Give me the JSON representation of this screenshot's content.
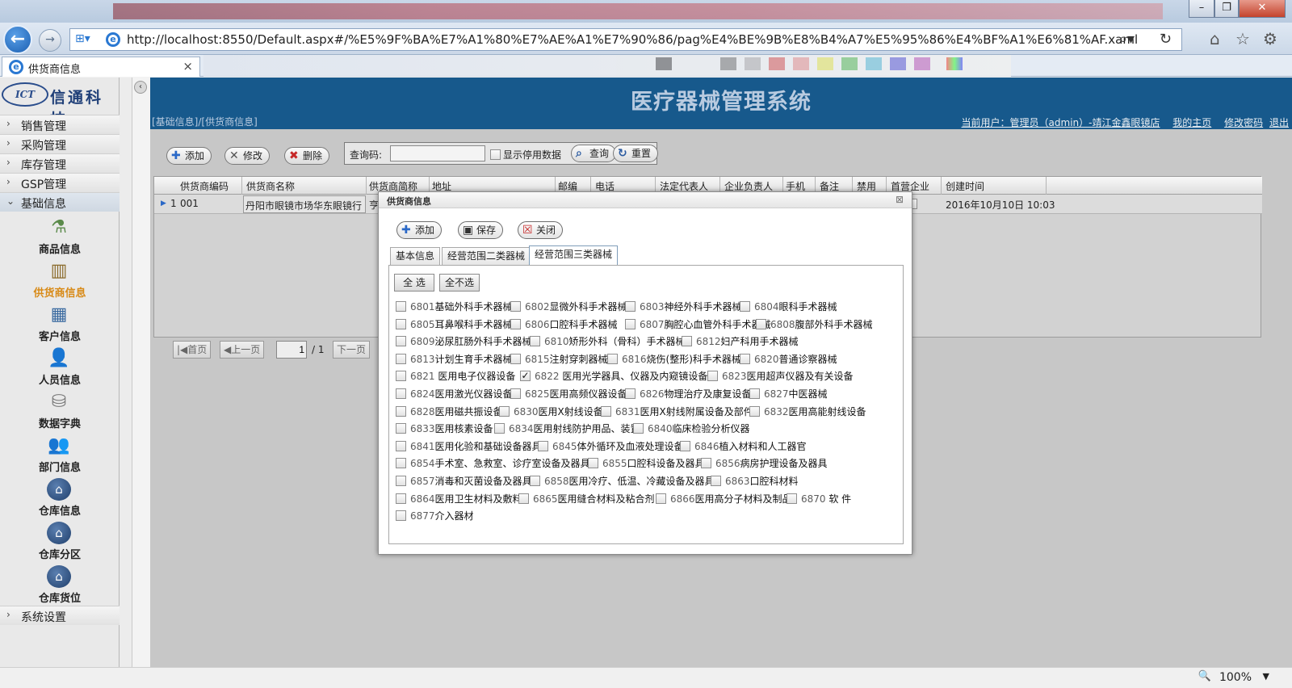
{
  "browser": {
    "url": "http://localhost:8550/Default.aspx#/%E5%9F%BA%E7%A1%80%E7%AE%A1%E7%90%86/pag%E4%BE%9B%E8%B4%A7%E5%95%86%E4%BF%A1%E6%81%AF.xaml",
    "tab_title": "供货商信息",
    "zoom": "100%"
  },
  "logo": {
    "mark": "ICT",
    "name": "信通科技"
  },
  "sidebar": {
    "menus": [
      {
        "label": "销售管理",
        "arrow": "›"
      },
      {
        "label": "采购管理",
        "arrow": "›"
      },
      {
        "label": "库存管理",
        "arrow": "›"
      },
      {
        "label": "GSP管理",
        "arrow": "›"
      },
      {
        "label": "基础信息",
        "arrow": "⌄"
      }
    ],
    "subitems": [
      {
        "label": "商品信息"
      },
      {
        "label": "供货商信息"
      },
      {
        "label": "客户信息"
      },
      {
        "label": "人员信息"
      },
      {
        "label": "数据字典"
      },
      {
        "label": "部门信息"
      },
      {
        "label": "仓库信息"
      },
      {
        "label": "仓库分区"
      },
      {
        "label": "仓库货位"
      }
    ],
    "bottom_menu": {
      "label": "系统设置",
      "arrow": "›"
    }
  },
  "header": {
    "title": "医疗器械管理系统",
    "breadcrumb": "[基础信息]/[供货商信息]",
    "user": "当前用户：管理员（admin）-靖江金鑫眼镜店",
    "links": [
      "我的主页",
      "修改密码",
      "退出"
    ]
  },
  "toolbar": {
    "add": "添加",
    "edit": "修改",
    "delete": "删除",
    "query_label": "查询码:",
    "query_value": "",
    "show_disabled": "显示停用数据",
    "search": "查询",
    "reset": "重置"
  },
  "grid": {
    "headers": [
      "供货商编码",
      "供货商名称",
      "供货商简称",
      "地址",
      "邮编",
      "电话",
      "法定代表人",
      "企业负责人",
      "手机",
      "备注",
      "禁用",
      "首营企业",
      "创建时间"
    ],
    "row": {
      "index": "1",
      "code": "001",
      "name": "丹阳市眼镜市场华东眼镜行",
      "short": "亨",
      "created": "2016年10月10日  10:03"
    }
  },
  "pager": {
    "first": "首页",
    "prev": "上一页",
    "page": "1",
    "total": "/ 1",
    "next": "下一页"
  },
  "dialog": {
    "title": "供货商信息",
    "add": "添加",
    "save": "保存",
    "close": "关闭",
    "tabs": [
      "基本信息",
      "经营范围二类器械",
      "经营范围三类器械"
    ],
    "select_all": "全 选",
    "select_none": "全不选",
    "items": [
      {
        "code": "6801",
        "name": "基础外科手术器械",
        "checked": false
      },
      {
        "code": "6802",
        "name": "显微外科手术器械",
        "checked": false
      },
      {
        "code": "6803",
        "name": "神经外科手术器械",
        "checked": false
      },
      {
        "code": "6804",
        "name": "眼科手术器械",
        "checked": false
      },
      {
        "code": "6805",
        "name": "耳鼻喉科手术器械",
        "checked": false
      },
      {
        "code": "6806",
        "name": "口腔科手术器械",
        "checked": false
      },
      {
        "code": "6807",
        "name": "胸腔心血管外科手术器械",
        "checked": false
      },
      {
        "code": "6808",
        "name": "腹部外科手术器械",
        "checked": false
      },
      {
        "code": "6809",
        "name": "泌尿肛肠外科手术器械",
        "checked": false
      },
      {
        "code": "6810",
        "name": "矫形外科（骨科）手术器械",
        "checked": false
      },
      {
        "code": "6812",
        "name": "妇产科用手术器械",
        "checked": false
      },
      {
        "code": "6813",
        "name": "计划生育手术器械",
        "checked": false
      },
      {
        "code": "6815",
        "name": "注射穿刺器械",
        "checked": false
      },
      {
        "code": "6816",
        "name": "烧伤(整形)科手术器械",
        "checked": false
      },
      {
        "code": "6820",
        "name": "普通诊察器械",
        "checked": false
      },
      {
        "code": "6821",
        "name": " 医用电子仪器设备",
        "checked": false
      },
      {
        "code": "6822",
        "name": " 医用光学器具、仪器及内窥镜设备",
        "checked": true
      },
      {
        "code": "6823",
        "name": "医用超声仪器及有关设备",
        "checked": false
      },
      {
        "code": "6824",
        "name": "医用激光仪器设备",
        "checked": false
      },
      {
        "code": "6825",
        "name": "医用高频仪器设备",
        "checked": false
      },
      {
        "code": "6826",
        "name": "物理治疗及康复设备",
        "checked": false
      },
      {
        "code": "6827",
        "name": "中医器械",
        "checked": false
      },
      {
        "code": "6828",
        "name": "医用磁共振设备",
        "checked": false
      },
      {
        "code": "6830",
        "name": "医用X射线设备",
        "checked": false
      },
      {
        "code": "6831",
        "name": "医用X射线附属设备及部件",
        "checked": false
      },
      {
        "code": "6832",
        "name": "医用高能射线设备",
        "checked": false
      },
      {
        "code": "6833",
        "name": "医用核素设备",
        "checked": false
      },
      {
        "code": "6834",
        "name": "医用射线防护用品、装置",
        "checked": false
      },
      {
        "code": "6840",
        "name": "临床检验分析仪器",
        "checked": false
      },
      {
        "code": "6841",
        "name": "医用化验和基础设备器具",
        "checked": false
      },
      {
        "code": "6845",
        "name": "体外循环及血液处理设备",
        "checked": false
      },
      {
        "code": "6846",
        "name": "植入材料和人工器官",
        "checked": false
      },
      {
        "code": "6854",
        "name": "手术室、急救室、诊疗室设备及器具",
        "checked": false
      },
      {
        "code": "6855",
        "name": "口腔科设备及器具",
        "checked": false
      },
      {
        "code": "6856",
        "name": "病房护理设备及器具",
        "checked": false
      },
      {
        "code": "6857",
        "name": "消毒和灭菌设备及器具",
        "checked": false
      },
      {
        "code": "6858",
        "name": "医用冷疗、低温、冷藏设备及器具",
        "checked": false
      },
      {
        "code": "6863",
        "name": "口腔科材料",
        "checked": false
      },
      {
        "code": "6864",
        "name": "医用卫生材料及敷料",
        "checked": false
      },
      {
        "code": "6865",
        "name": "医用缝合材料及粘合剂",
        "checked": false
      },
      {
        "code": "6866",
        "name": "医用高分子材料及制品",
        "checked": false
      },
      {
        "code": "6870",
        "name": " 软  件",
        "checked": false
      },
      {
        "code": "6877",
        "name": "介入器材",
        "checked": false
      }
    ],
    "rows": [
      [
        "6801",
        "6802",
        "6803",
        "6804"
      ],
      [
        "6805",
        "6806",
        "6807",
        "6808"
      ],
      [
        "6809",
        "6810",
        "6812"
      ],
      [
        "6813",
        "6815",
        "6816",
        "6820"
      ],
      [
        "6821",
        "6822",
        "6823"
      ],
      [
        "6824",
        "6825",
        "6826",
        "6827"
      ],
      [
        "6828",
        "6830",
        "6831",
        "6832"
      ],
      [
        "6833",
        "6834",
        "6840"
      ],
      [
        "6841",
        "6845",
        "6846"
      ],
      [
        "6854",
        "6855",
        "6856"
      ],
      [
        "6857",
        "6858",
        "6863"
      ],
      [
        "6864",
        "6865",
        "6866",
        "6870"
      ],
      [
        "6877"
      ]
    ]
  }
}
